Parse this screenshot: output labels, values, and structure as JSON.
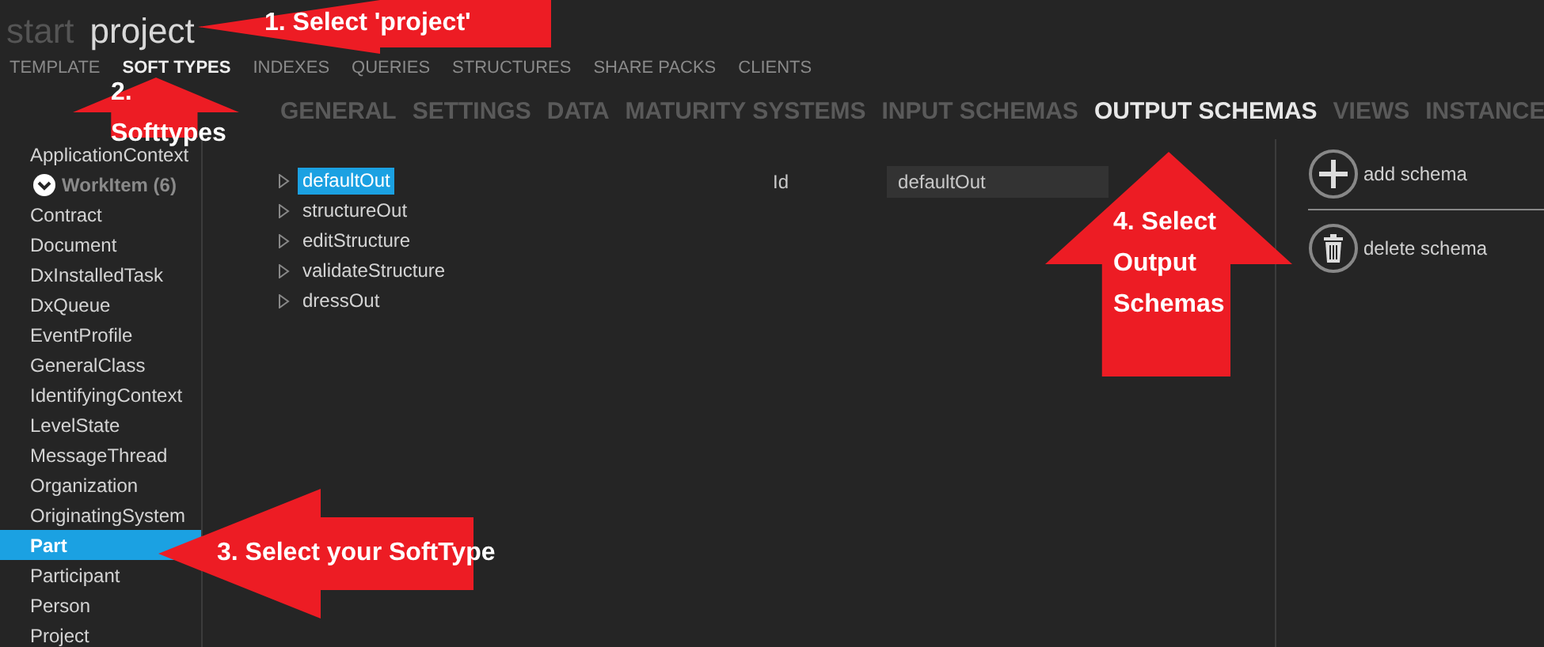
{
  "breadcrumb": [
    {
      "label": "start",
      "selected": false
    },
    {
      "label": "project",
      "selected": true
    }
  ],
  "top_tabs": [
    {
      "label": "TEMPLATE",
      "selected": false
    },
    {
      "label": "SOFT TYPES",
      "selected": true
    },
    {
      "label": "INDEXES",
      "selected": false
    },
    {
      "label": "QUERIES",
      "selected": false
    },
    {
      "label": "STRUCTURES",
      "selected": false
    },
    {
      "label": "SHARE PACKS",
      "selected": false
    },
    {
      "label": "CLIENTS",
      "selected": false
    }
  ],
  "section_tabs": [
    {
      "label": "GENERAL",
      "selected": false
    },
    {
      "label": "SETTINGS",
      "selected": false
    },
    {
      "label": "DATA",
      "selected": false
    },
    {
      "label": "MATURITY SYSTEMS",
      "selected": false
    },
    {
      "label": "INPUT SCHEMAS",
      "selected": false
    },
    {
      "label": "OUTPUT SCHEMAS",
      "selected": true
    },
    {
      "label": "VIEWS",
      "selected": false
    },
    {
      "label": "INSTANCE",
      "selected": false
    }
  ],
  "sidebar": {
    "items": [
      {
        "kind": "item",
        "label": "ApplicationContext",
        "selected": false
      },
      {
        "kind": "group",
        "label": "WorkItem (6)",
        "expanded": true
      },
      {
        "kind": "item",
        "label": "Contract",
        "selected": false
      },
      {
        "kind": "item",
        "label": "Document",
        "selected": false
      },
      {
        "kind": "item",
        "label": "DxInstalledTask",
        "selected": false
      },
      {
        "kind": "item",
        "label": "DxQueue",
        "selected": false
      },
      {
        "kind": "item",
        "label": "EventProfile",
        "selected": false
      },
      {
        "kind": "item",
        "label": "GeneralClass",
        "selected": false
      },
      {
        "kind": "item",
        "label": "IdentifyingContext",
        "selected": false
      },
      {
        "kind": "item",
        "label": "LevelState",
        "selected": false
      },
      {
        "kind": "item",
        "label": "MessageThread",
        "selected": false
      },
      {
        "kind": "item",
        "label": "Organization",
        "selected": false
      },
      {
        "kind": "item",
        "label": "OriginatingSystem",
        "selected": false
      },
      {
        "kind": "item",
        "label": "Part",
        "selected": true
      },
      {
        "kind": "item",
        "label": "Participant",
        "selected": false
      },
      {
        "kind": "item",
        "label": "Person",
        "selected": false
      },
      {
        "kind": "item",
        "label": "Project",
        "selected": false
      }
    ]
  },
  "schemas": [
    {
      "label": "defaultOut",
      "selected": true,
      "expanded": false
    },
    {
      "label": "structureOut",
      "selected": false,
      "expanded": false
    },
    {
      "label": "editStructure",
      "selected": false,
      "expanded": false
    },
    {
      "label": "validateStructure",
      "selected": false,
      "expanded": false
    },
    {
      "label": "dressOut",
      "selected": false,
      "expanded": false
    }
  ],
  "details": {
    "label": "Id",
    "value": "defaultOut"
  },
  "actions": [
    {
      "kind": "add",
      "label": "add schema"
    },
    {
      "kind": "delete",
      "label": "delete schema"
    }
  ],
  "annotations": [
    {
      "kind": "arrow-left",
      "lines": [
        "1. Select 'project'"
      ]
    },
    {
      "kind": "arrow-up",
      "lines": [
        "2.",
        "Softtypes"
      ]
    },
    {
      "kind": "arrow-left",
      "lines": [
        "3. Select your SoftType"
      ]
    },
    {
      "kind": "arrow-up",
      "lines": [
        "4. Select",
        "Output",
        "Schemas"
      ]
    }
  ]
}
